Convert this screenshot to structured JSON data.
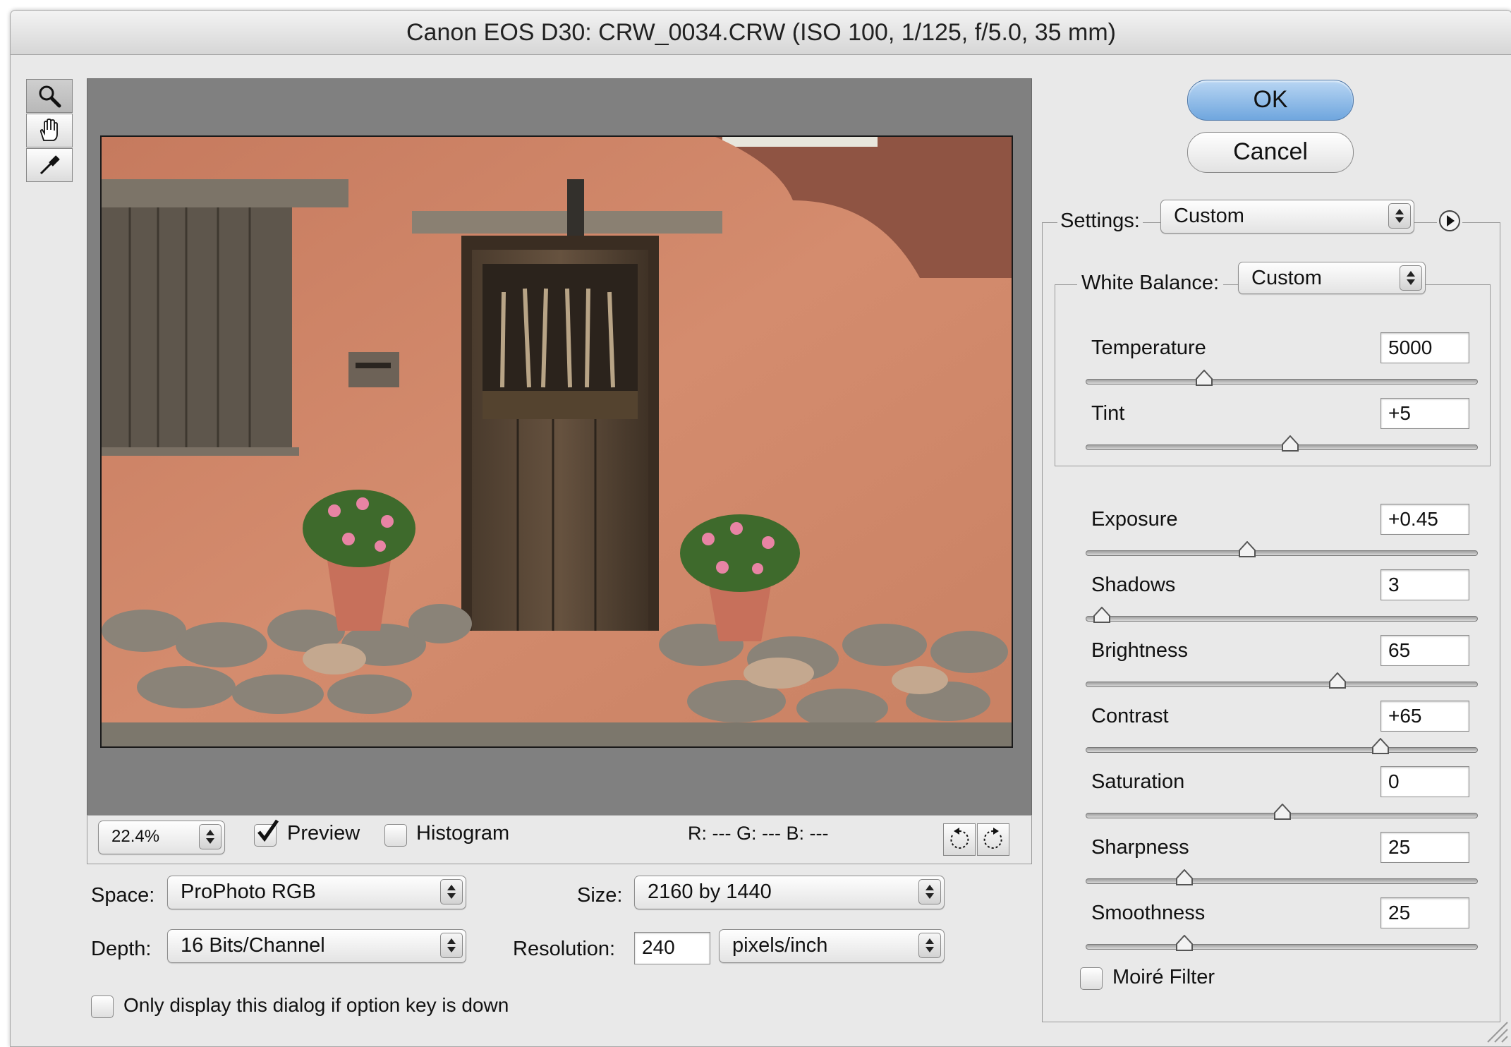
{
  "window": {
    "title": "Canon EOS D30:  CRW_0034.CRW  (ISO 100, 1/125, f/5.0, 35 mm)"
  },
  "tools": [
    {
      "name": "zoom-tool",
      "icon": "magnifier-icon"
    },
    {
      "name": "hand-tool",
      "icon": "hand-icon"
    },
    {
      "name": "white-balance-tool",
      "icon": "eyedropper-icon"
    }
  ],
  "preview_bar": {
    "zoom": "22.4%",
    "preview_label": "Preview",
    "preview_checked": true,
    "histogram_label": "Histogram",
    "histogram_checked": false,
    "rgb_readout": "R: --- G: --- B: ---"
  },
  "workflow": {
    "space_label": "Space:",
    "space_value": "ProPhoto RGB",
    "depth_label": "Depth:",
    "depth_value": "16 Bits/Channel",
    "size_label": "Size:",
    "size_value": "2160 by 1440",
    "resolution_label": "Resolution:",
    "resolution_value": "240",
    "resolution_unit": "pixels/inch",
    "option_key_label": "Only display this dialog if option key is down"
  },
  "buttons": {
    "ok": "OK",
    "cancel": "Cancel"
  },
  "settings": {
    "label": "Settings:",
    "value": "Custom"
  },
  "white_balance": {
    "label": "White Balance:",
    "value": "Custom",
    "temperature": {
      "label": "Temperature",
      "value": "5000",
      "slider_pos": 0.3
    },
    "tint": {
      "label": "Tint",
      "value": "+5",
      "slider_pos": 0.52
    }
  },
  "adjustments": {
    "exposure": {
      "label": "Exposure",
      "value": "+0.45",
      "slider_pos": 0.41
    },
    "shadows": {
      "label": "Shadows",
      "value": "3",
      "slider_pos": 0.04
    },
    "brightness": {
      "label": "Brightness",
      "value": "65",
      "slider_pos": 0.64
    },
    "contrast": {
      "label": "Contrast",
      "value": "+65",
      "slider_pos": 0.75
    },
    "saturation": {
      "label": "Saturation",
      "value": "0",
      "slider_pos": 0.5
    },
    "sharpness": {
      "label": "Sharpness",
      "value": "25",
      "slider_pos": 0.25
    },
    "smoothness": {
      "label": "Smoothness",
      "value": "25",
      "slider_pos": 0.25
    }
  },
  "moire": {
    "label": "Moiré Filter",
    "checked": false
  }
}
